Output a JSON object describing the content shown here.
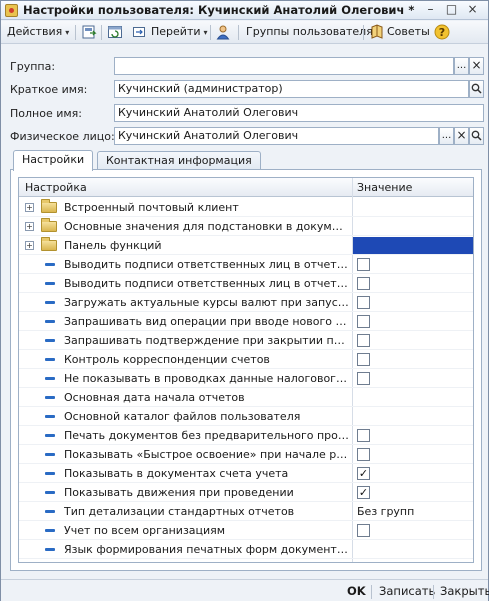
{
  "window": {
    "title": "Настройки пользователя: Кучинский Анатолий Олегович *",
    "controls": [
      "–",
      "□",
      "×"
    ]
  },
  "toolbar": {
    "actions_label": "Действия",
    "goto_label": "Перейти",
    "user_groups_label": "Группы пользователя",
    "tips_label": "Советы"
  },
  "form": {
    "group": {
      "label": "Группа:",
      "value": ""
    },
    "short_name": {
      "label": "Краткое имя:",
      "value": "Кучинский (администратор)"
    },
    "full_name": {
      "label": "Полное имя:",
      "value": "Кучинский Анатолий Олегович"
    },
    "person": {
      "label": "Физическое лицо:",
      "value": "Кучинский Анатолий Олегович"
    }
  },
  "tabs": [
    {
      "label": "Настройки",
      "active": true
    },
    {
      "label": "Контактная информация",
      "active": false
    }
  ],
  "table": {
    "columns": [
      "Настройка",
      "Значение"
    ],
    "rows": [
      {
        "kind": "group",
        "name": "Встроенный почтовый клиент",
        "value_type": "none"
      },
      {
        "kind": "group",
        "name": "Основные значения для подстановки в документы и ...",
        "value_type": "none"
      },
      {
        "kind": "group",
        "name": "Панель функций",
        "value_type": "selected"
      },
      {
        "kind": "item",
        "name": "Выводить подписи ответственных лиц в отчете \"Расч...",
        "value_type": "checkbox",
        "checked": false
      },
      {
        "kind": "item",
        "name": "Выводить подписи ответственных лиц в отчете \"Свод...",
        "value_type": "checkbox",
        "checked": false
      },
      {
        "kind": "item",
        "name": "Загружать актуальные курсы валют при запуске сис...",
        "value_type": "checkbox",
        "checked": false
      },
      {
        "kind": "item",
        "name": "Запрашивать вид операции при вводе нового докуме...",
        "value_type": "checkbox",
        "checked": false
      },
      {
        "kind": "item",
        "name": "Запрашивать подтверждение при закрытии програм...",
        "value_type": "checkbox",
        "checked": false
      },
      {
        "kind": "item",
        "name": "Контроль корреспонденции счетов",
        "value_type": "checkbox",
        "checked": false
      },
      {
        "kind": "item",
        "name": "Не показывать в проводках данные налогового учет...",
        "value_type": "checkbox",
        "checked": false
      },
      {
        "kind": "item",
        "name": "Основная дата начала отчетов",
        "value_type": "text",
        "value": ""
      },
      {
        "kind": "item",
        "name": "Основной каталог файлов пользователя",
        "value_type": "text",
        "value": ""
      },
      {
        "kind": "item",
        "name": "Печать документов без предварительного просмотра",
        "value_type": "checkbox",
        "checked": false
      },
      {
        "kind": "item",
        "name": "Показывать «Быстрое освоение» при начале работы...",
        "value_type": "checkbox",
        "checked": false
      },
      {
        "kind": "item",
        "name": "Показывать в документах счета учета",
        "value_type": "checkbox",
        "checked": true
      },
      {
        "kind": "item",
        "name": "Показывать движения при проведении",
        "value_type": "checkbox",
        "checked": true
      },
      {
        "kind": "item",
        "name": "Тип детализации стандартных отчетов",
        "value_type": "text",
        "value": "Без групп"
      },
      {
        "kind": "item",
        "name": "Учет по всем организациям",
        "value_type": "checkbox",
        "checked": false
      },
      {
        "kind": "item",
        "name": "Язык формирования печатных форм документов",
        "value_type": "text",
        "value": ""
      }
    ]
  },
  "footer": {
    "ok_label": "OK",
    "save_label": "Записать",
    "close_label": "Закрыть"
  },
  "glyphs": {
    "select": "...",
    "clear": "×",
    "search": "⌕",
    "expand": "+",
    "check": "✓",
    "dropdown": "▾"
  },
  "colors": {
    "selection": "#1e49b5",
    "item_marker": "#2a6bc4",
    "accent_folder": "#d9b64f"
  }
}
